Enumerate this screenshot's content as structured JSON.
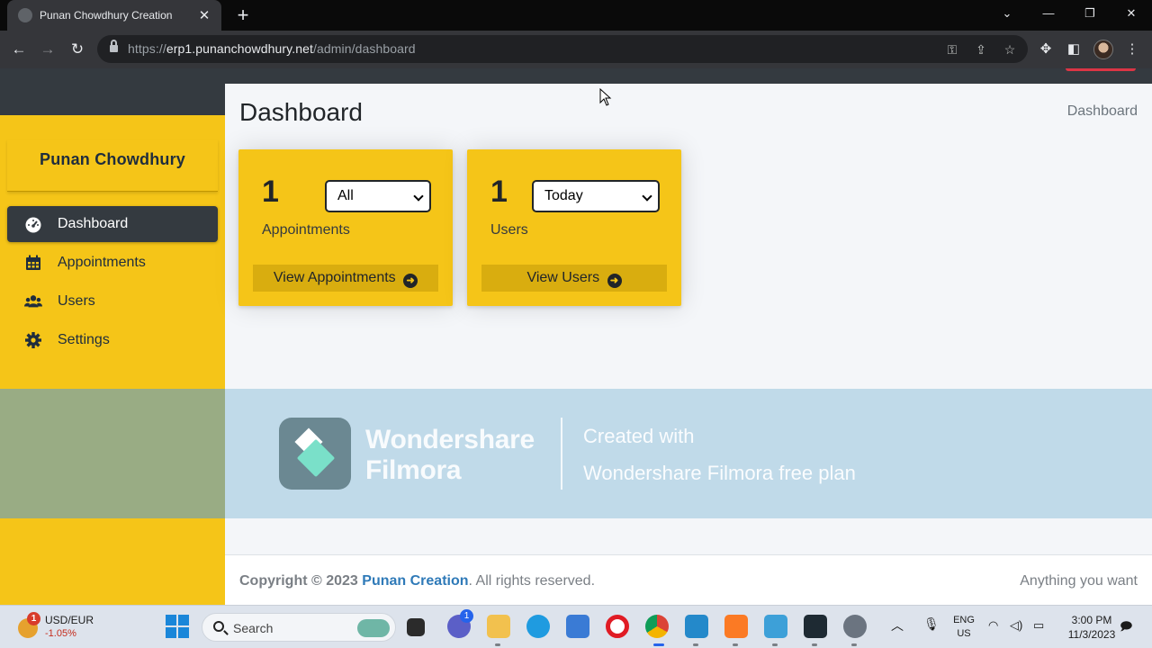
{
  "browser": {
    "tab_title": "Punan Chowdhury Creation",
    "tab_close": "✕",
    "new_tab": "+",
    "url_prefix": "https://",
    "url_host": "erp1.punanchowdhury.net",
    "url_path": "/admin/dashboard",
    "window_controls": {
      "chevron": "⌄",
      "minimize": "—",
      "restore": "❐",
      "close": "✕"
    }
  },
  "sidebar": {
    "brand": "Punan Chowdhury",
    "items": [
      {
        "label": "Dashboard",
        "icon": "tachometer-icon",
        "active": true
      },
      {
        "label": "Appointments",
        "icon": "calendar-icon",
        "active": false
      },
      {
        "label": "Users",
        "icon": "users-icon",
        "active": false
      },
      {
        "label": "Settings",
        "icon": "gear-icon",
        "active": false
      }
    ]
  },
  "header": {
    "title": "Dashboard",
    "breadcrumb": "Dashboard"
  },
  "cards": [
    {
      "count": "1",
      "label": "Appointments",
      "filter": "All",
      "link": "View Appointments"
    },
    {
      "count": "1",
      "label": "Users",
      "filter": "Today",
      "link": "View Users"
    }
  ],
  "watermark": {
    "brand_line1": "Wondershare",
    "brand_line2": "Filmora",
    "created": "Created with",
    "plan": "Wondershare Filmora free plan"
  },
  "footer": {
    "copyright_prefix": "Copyright © 2023",
    "company": "Punan Creation",
    "suffix": ". All rights reserved.",
    "right": "Anything you want"
  },
  "taskbar": {
    "weather_badge": "1",
    "ticker_pair": "USD/EUR",
    "ticker_change": "-1.05%",
    "search_placeholder": "Search",
    "chat_badge": "1",
    "lang_line1": "ENG",
    "lang_line2": "US",
    "time": "3:00 PM",
    "date": "11/3/2023"
  },
  "colors": {
    "sidebar_accent": "#f5c518",
    "dark": "#343a40",
    "link": "#2f7ab8"
  }
}
